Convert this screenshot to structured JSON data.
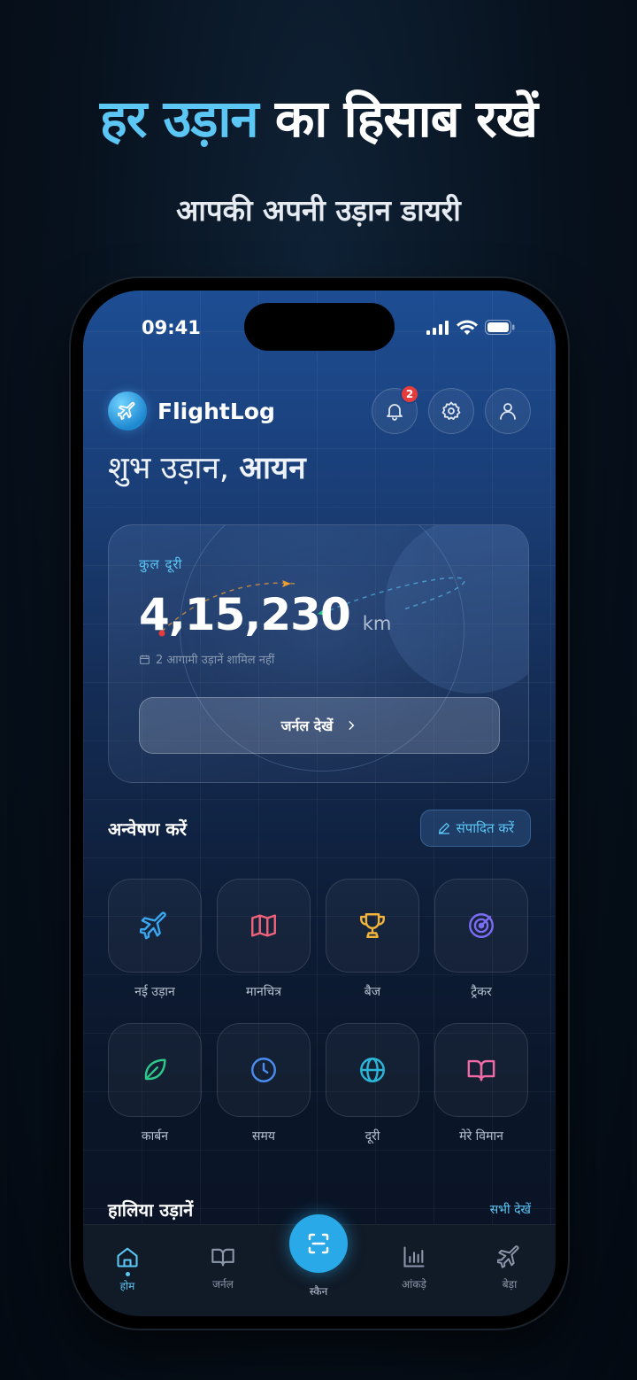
{
  "promo": {
    "title_accent": "हर उड़ान",
    "title_rest": "का हिसाब रखें",
    "subtitle": "आपकी अपनी उड़ान डायरी"
  },
  "status_bar": {
    "time": "09:41"
  },
  "header": {
    "app_name": "FlightLog",
    "notification_count": "2"
  },
  "greeting": {
    "prefix": "शुभ उड़ान,",
    "name": "आयन"
  },
  "distance_card": {
    "label": "कुल दूरी",
    "value": "4,15,230",
    "unit": "km",
    "note": "2 आगामी उड़ानें शामिल नहीं",
    "button_label": "जर्नल देखें"
  },
  "explore": {
    "title": "अन्वेषण करें",
    "edit_label": "संपादित करें",
    "tiles": [
      {
        "label": "नई उड़ान",
        "icon": "airplane-icon",
        "color": "#3aa8f0"
      },
      {
        "label": "मानचित्र",
        "icon": "map-icon",
        "color": "#f0627a"
      },
      {
        "label": "बैज",
        "icon": "trophy-icon",
        "color": "#f2b43a"
      },
      {
        "label": "ट्रैकर",
        "icon": "radar-icon",
        "color": "#7c6cf2"
      },
      {
        "label": "कार्बन",
        "icon": "leaf-icon",
        "color": "#2ec98a"
      },
      {
        "label": "समय",
        "icon": "clock-icon",
        "color": "#4a8cf0"
      },
      {
        "label": "दूरी",
        "icon": "globe-icon",
        "color": "#2bb8d8"
      },
      {
        "label": "मेरे विमान",
        "icon": "book-icon",
        "color": "#f06aa6"
      }
    ]
  },
  "recent": {
    "title": "हालिया उड़ानें",
    "see_all": "सभी देखें"
  },
  "tab_bar": {
    "tabs": [
      {
        "label": "होम",
        "icon": "home-icon"
      },
      {
        "label": "जर्नल",
        "icon": "journal-icon"
      },
      {
        "label": "स्कैन",
        "icon": "scan-icon"
      },
      {
        "label": "आंकड़े",
        "icon": "stats-icon"
      },
      {
        "label": "बेड़ा",
        "icon": "fleet-icon"
      }
    ],
    "active": "होम"
  },
  "colors": {
    "accent": "#5cc6f5",
    "badge": "#e53b3b",
    "fab": "#29a9e8"
  }
}
